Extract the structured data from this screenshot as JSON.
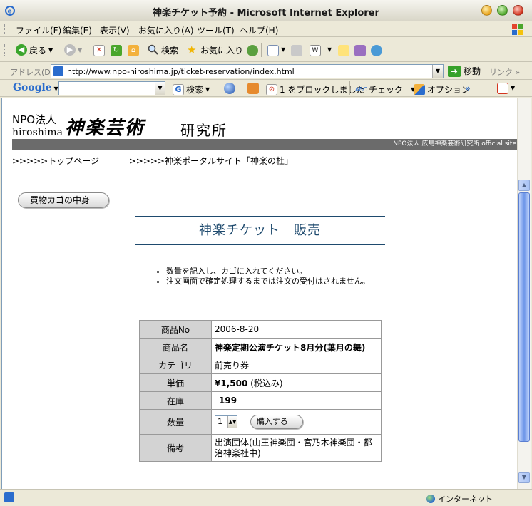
{
  "window": {
    "title": "神楽チケット予約 - Microsoft Internet Explorer"
  },
  "menu": [
    "ファイル(F)",
    "編集(E)",
    "表示(V)",
    "お気に入り(A)",
    "ツール(T)",
    "ヘルプ(H)"
  ],
  "toolbar": {
    "back": "戻る",
    "search": "検索",
    "favorites": "お気に入り"
  },
  "address": {
    "label": "アドレス(D)",
    "url": "http://www.npo-hiroshima.jp/ticket-reservation/index.html",
    "go": "移動",
    "links": "リンク"
  },
  "google_bar": {
    "logo": "Google",
    "search_btn": "検索",
    "blocked": "1 をブロックしました",
    "check": "チェック",
    "options": "オプション"
  },
  "site": {
    "npo": "NPO法人",
    "npo_sub": "hiroshima",
    "logo": "神楽芸術",
    "name": "研究所",
    "band": "NPO法人 広島神楽芸術研究所 official site",
    "links": [
      {
        "prefix": ">>>>>",
        "label": "トップページ"
      },
      {
        "prefix": ">>>>>",
        "label": "神楽ポータルサイト「神楽の杜」"
      }
    ],
    "cart_button": "買物カゴの中身",
    "heading": "神楽チケット　販売",
    "notes": [
      "数量を記入し、カゴに入れてください。",
      "注文画面で確定処理するまでは注文の受付はされません。"
    ]
  },
  "product": {
    "labels": {
      "no": "商品No",
      "name": "商品名",
      "category": "カテゴリ",
      "price": "単価",
      "stock": "在庫",
      "qty": "数量",
      "remarks": "備考"
    },
    "no": "2006-8-20",
    "name": "神楽定期公演チケット8月分(葉月の舞)",
    "category": "前売り券",
    "price": "¥1,500",
    "price_note": "(税込み)",
    "stock": "199",
    "qty": "1",
    "buy_button": "購入する",
    "remarks": "出演団体(山王神楽団・宮乃木神楽団・都治神楽社中)"
  },
  "status": {
    "zone": "インターネット"
  }
}
